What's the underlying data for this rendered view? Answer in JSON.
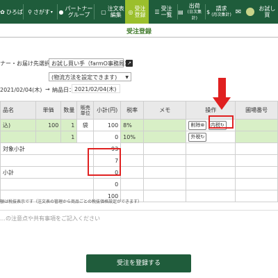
{
  "nav": {
    "items": [
      {
        "icon": "✿",
        "label": "ひろば"
      },
      {
        "icon": "🔍",
        "label": "さがす",
        "chevron": "▾"
      },
      {
        "icon": "👤",
        "label": "パートナー",
        "label2": "グループ"
      },
      {
        "icon": "",
        "label": "注文表",
        "label2": "編集"
      },
      {
        "icon": "◎",
        "label": "受注",
        "label2": "登録"
      },
      {
        "icon": "☰",
        "label": "受注",
        "label2": "一覧"
      },
      {
        "icon": "📋",
        "label": "出荷",
        "sub": "(日次集計)"
      },
      {
        "icon": "$",
        "label": "請求",
        "sub": "(月次集計)"
      },
      {
        "icon": "✉",
        "label": ""
      },
      {
        "icon": "",
        "label": "お試し買"
      }
    ]
  },
  "page_title": "受注登録",
  "form": {
    "partner_label": "ナー・お届け先選択",
    "partner_value": "お試し買い手（farmO事務局）",
    "shipping_select": "(物流方法を設定できます)",
    "order_date": "2021/02/04(木)",
    "arrow": "→",
    "delivery_label": "納品日：",
    "delivery_date": "2021/02/04(木)"
  },
  "table": {
    "headers": [
      "品名",
      "単価",
      "数量",
      "販売単位",
      "小計(円)",
      "税率",
      "メモ",
      "操作",
      "圃場番号"
    ],
    "rows": [
      {
        "name": "込)",
        "price": "100",
        "qty": "1",
        "unit": "袋",
        "subtotal": "100",
        "tax": "8%",
        "memo": "",
        "op1": "削除",
        "op2": "内税",
        "field": ""
      },
      {
        "name": "",
        "price": "",
        "qty": "1",
        "unit": "",
        "subtotal": "0",
        "tax": "10%",
        "memo": "",
        "op1": "外税",
        "op2": "",
        "field": ""
      }
    ],
    "summary": [
      {
        "label": "対象小計",
        "value": "93"
      },
      {
        "label": "",
        "value": "7"
      },
      {
        "label": "小計",
        "value": "0"
      },
      {
        "label": "",
        "value": "0"
      },
      {
        "label": "",
        "value": "100"
      }
    ],
    "footnote": "額は税抜表示です（注文表の管理から商品ごとの税抜価格設定ができます）"
  },
  "memo_placeholder": "…の注意点や共有事項をご記入ください",
  "submit_label": "受注を登録する",
  "colors": {
    "topbar": "#1f5c3b",
    "active": "#9bbf2c",
    "highlight": "#e02020",
    "cell_green": "#d8efc6"
  }
}
